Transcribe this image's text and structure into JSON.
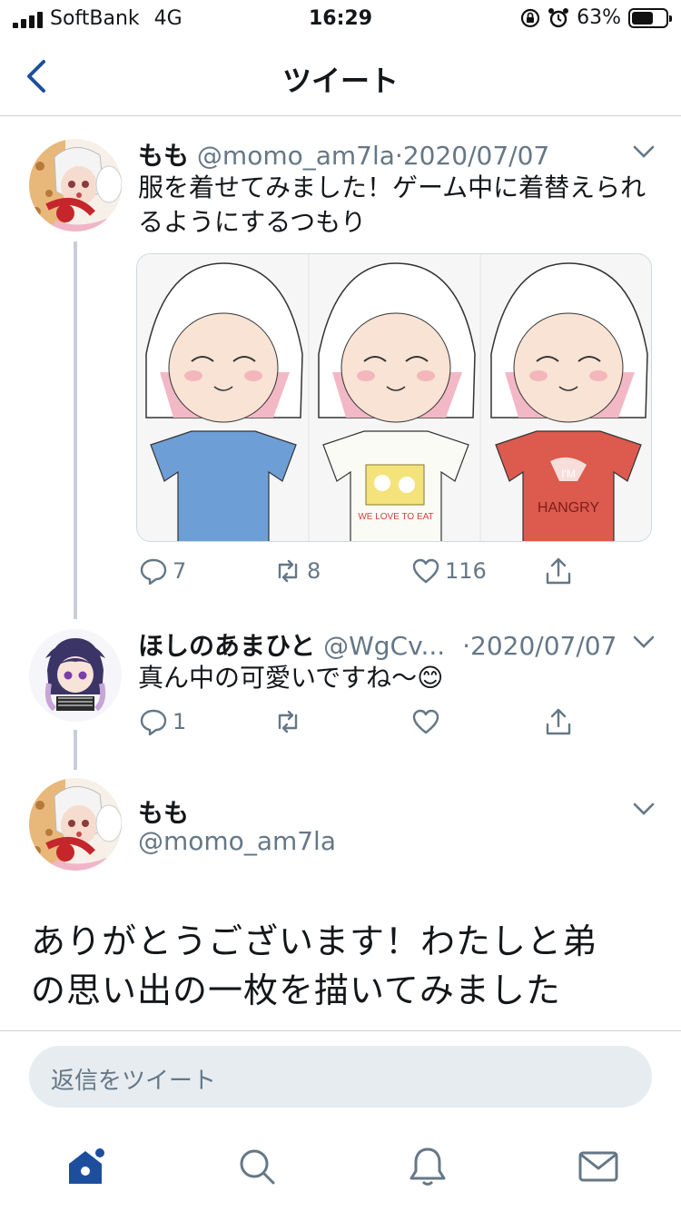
{
  "status": {
    "carrier": "SoftBank",
    "network": "4G",
    "time": "16:29",
    "battery_text": "63%",
    "battery_level": 0.63
  },
  "header": {
    "title": "ツイート"
  },
  "tweets": [
    {
      "display_name": "もも",
      "handle": "@momo_am7la",
      "date": "2020/07/07",
      "text_line1": "服を着せてみました！ゲーム中に着替えられ",
      "text_line2": "るようにするつもり",
      "media_labels": [
        "WE LOVE TO EAT",
        "I'M",
        "HANGRY"
      ],
      "reply_count": "7",
      "retweet_count": "8",
      "like_count": "116"
    },
    {
      "display_name": "ほしのあまひと",
      "handle": "@WgCv...",
      "date": "2020/07/07",
      "text": "真ん中の可愛いですね〜😊",
      "reply_count": "1"
    }
  ],
  "focused_tweet": {
    "display_name": "もも",
    "handle": "@momo_am7la",
    "text_line1": "ありがとうございます！わたしと弟",
    "text_line2": "の思い出の一枚を描いてみました"
  },
  "reply": {
    "placeholder": "返信をツイート"
  },
  "tabs": [
    "home-icon",
    "search-icon",
    "notifications-icon",
    "messages-icon"
  ],
  "colors": {
    "accent": "#1d4e9e",
    "muted": "#657786"
  }
}
